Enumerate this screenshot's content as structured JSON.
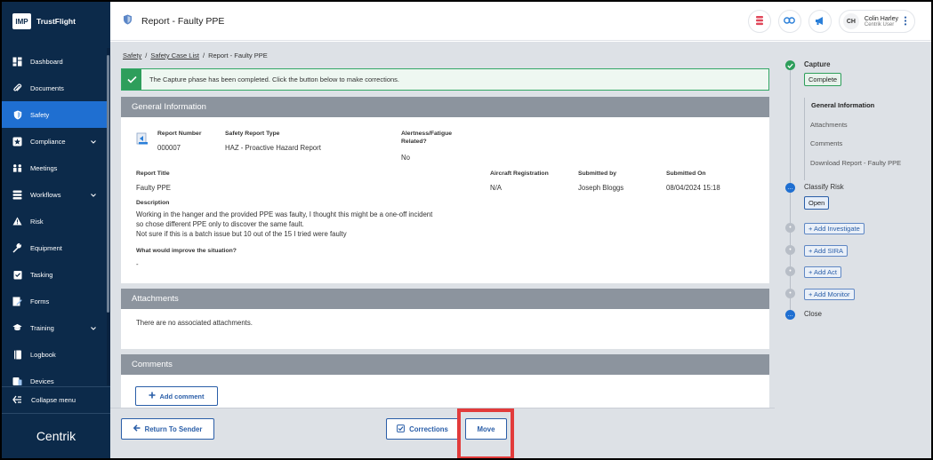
{
  "brand": {
    "logo_text": "IMP",
    "name": "TrustFlight",
    "footer_logo": "Centrik"
  },
  "sidebar": {
    "items": [
      {
        "label": "Dashboard",
        "icon": "dashboard-icon"
      },
      {
        "label": "Documents",
        "icon": "paperclip-icon"
      },
      {
        "label": "Safety",
        "icon": "shield-icon",
        "active": true
      },
      {
        "label": "Compliance",
        "icon": "compliance-icon",
        "chevron": true
      },
      {
        "label": "Meetings",
        "icon": "meetings-icon"
      },
      {
        "label": "Workflows",
        "icon": "workflows-icon",
        "chevron": true
      },
      {
        "label": "Risk",
        "icon": "warning-icon"
      },
      {
        "label": "Equipment",
        "icon": "wrench-icon"
      },
      {
        "label": "Tasking",
        "icon": "tasking-icon"
      },
      {
        "label": "Forms",
        "icon": "forms-icon"
      },
      {
        "label": "Training",
        "icon": "graduation-cap-icon",
        "chevron": true
      },
      {
        "label": "Logbook",
        "icon": "book-icon"
      },
      {
        "label": "Devices",
        "icon": "devices-icon"
      }
    ],
    "collapse_label": "Collapse menu"
  },
  "header": {
    "title": "Report",
    "subtitle": "Faulty PPE",
    "user": {
      "initials": "CH",
      "name": "Colin Harley",
      "role": "Centrik User"
    }
  },
  "breadcrumb": {
    "items": [
      "Safety",
      "Safety Case List"
    ],
    "current": "Report - Faulty PPE",
    "sep": "/"
  },
  "alert": {
    "text": "The Capture phase has been completed. Click the button below to make corrections."
  },
  "general": {
    "heading": "General Information",
    "report_number_label": "Report Number",
    "report_number": "000007",
    "report_type_label": "Safety Report Type",
    "report_type": "HAZ - Proactive Hazard Report",
    "alertness_label_1": "Alertness/Fatigue",
    "alertness_label_2": "Related?",
    "alertness_value": "No",
    "title_label": "Report Title",
    "title_value": "Faulty PPE",
    "aircraft_label": "Aircraft Registration",
    "aircraft_value": "N/A",
    "submitted_by_label": "Submitted by",
    "submitted_by_value": "Joseph Bloggs",
    "submitted_on_label": "Submitted On",
    "submitted_on_value": "08/04/2024 15:18",
    "description_label": "Description",
    "description_lines": [
      "Working in the hanger and the provided PPE was faulty, I thought this might be a one-off incident",
      "so chose different PPE only to discover the same fault.",
      "Not sure if this is a batch issue but 10 out of the 15 I tried were faulty"
    ],
    "improve_label": "What would improve the situation?",
    "improve_value": "-"
  },
  "attachments": {
    "heading": "Attachments",
    "empty_text": "There are no associated attachments."
  },
  "comments": {
    "heading": "Comments",
    "add_label": "Add comment"
  },
  "footer": {
    "return_label": "Return To Sender",
    "corrections_label": "Corrections",
    "move_label": "Move"
  },
  "stepper": {
    "capture_label": "Capture",
    "capture_badge": "Complete",
    "capture_subs": [
      "General Information",
      "Attachments",
      "Comments",
      "Download Report - Faulty PPE"
    ],
    "classify_label": "Classify Risk",
    "classify_badge": "Open",
    "adds": [
      "+ Add Investigate",
      "+ Add SIRA",
      "+ Add Act",
      "+ Add Monitor"
    ],
    "close_label": "Close"
  },
  "colors": {
    "sidebar": "#0c2a4a",
    "active": "#1f6fd1",
    "success": "#2e9e5b",
    "accent": "#2a5ea8",
    "highlight": "#e23b3b"
  }
}
